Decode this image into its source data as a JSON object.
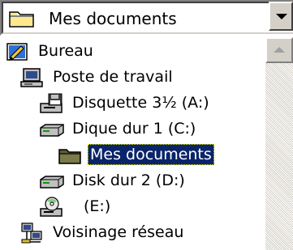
{
  "combo": {
    "selected": "Mes documents",
    "icon": "folder-icon"
  },
  "tree": {
    "items": [
      {
        "label": "Bureau",
        "icon": "desktop-icon"
      },
      {
        "label": "Poste de travail",
        "icon": "computer-icon"
      },
      {
        "label": "Disquette 3½ (A:)",
        "icon": "floppy-drive-icon"
      },
      {
        "label": "Dique dur 1 (C:)",
        "icon": "hard-drive-icon"
      },
      {
        "label": "Mes documents",
        "icon": "folder-icon",
        "selected": true
      },
      {
        "label": "Disk dur 2 (D:)",
        "icon": "hard-drive-icon"
      },
      {
        "label": "(E:)",
        "icon": "cd-drive-icon"
      },
      {
        "label": "Voisinage réseau",
        "icon": "network-icon"
      }
    ]
  },
  "colors": {
    "selection": "#0a246a",
    "face": "#d4d0c8"
  }
}
